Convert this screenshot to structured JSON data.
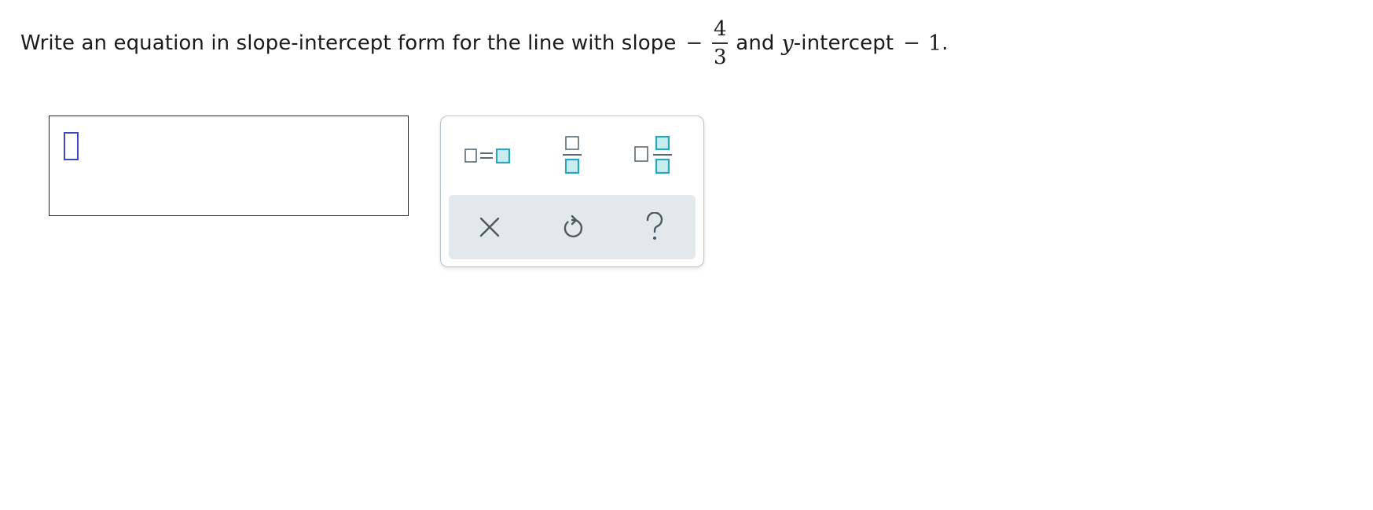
{
  "question": {
    "prefix": "Write an equation in slope-intercept form for the line with slope",
    "slope_sign": "−",
    "slope_numerator": "4",
    "slope_denominator": "3",
    "middle": "and",
    "y_var": "y",
    "intercept_text": "-intercept",
    "intercept_sign": "−",
    "intercept_value": "1",
    "period": "."
  },
  "answer_box": {
    "value": ""
  },
  "palette": {
    "top_row": [
      {
        "icon": "equation-template-icon"
      },
      {
        "icon": "fraction-template-icon"
      },
      {
        "icon": "mixed-number-template-icon"
      }
    ],
    "bottom_row": [
      {
        "icon": "clear-icon"
      },
      {
        "icon": "undo-icon"
      },
      {
        "icon": "help-icon"
      }
    ],
    "colors": {
      "accent": "#2aa7b8",
      "accent_fill": "#c9ecf1",
      "icon_gray": "#5a6a73",
      "panel_bg": "#e3e8ea",
      "cursor": "#3b46c8"
    }
  }
}
